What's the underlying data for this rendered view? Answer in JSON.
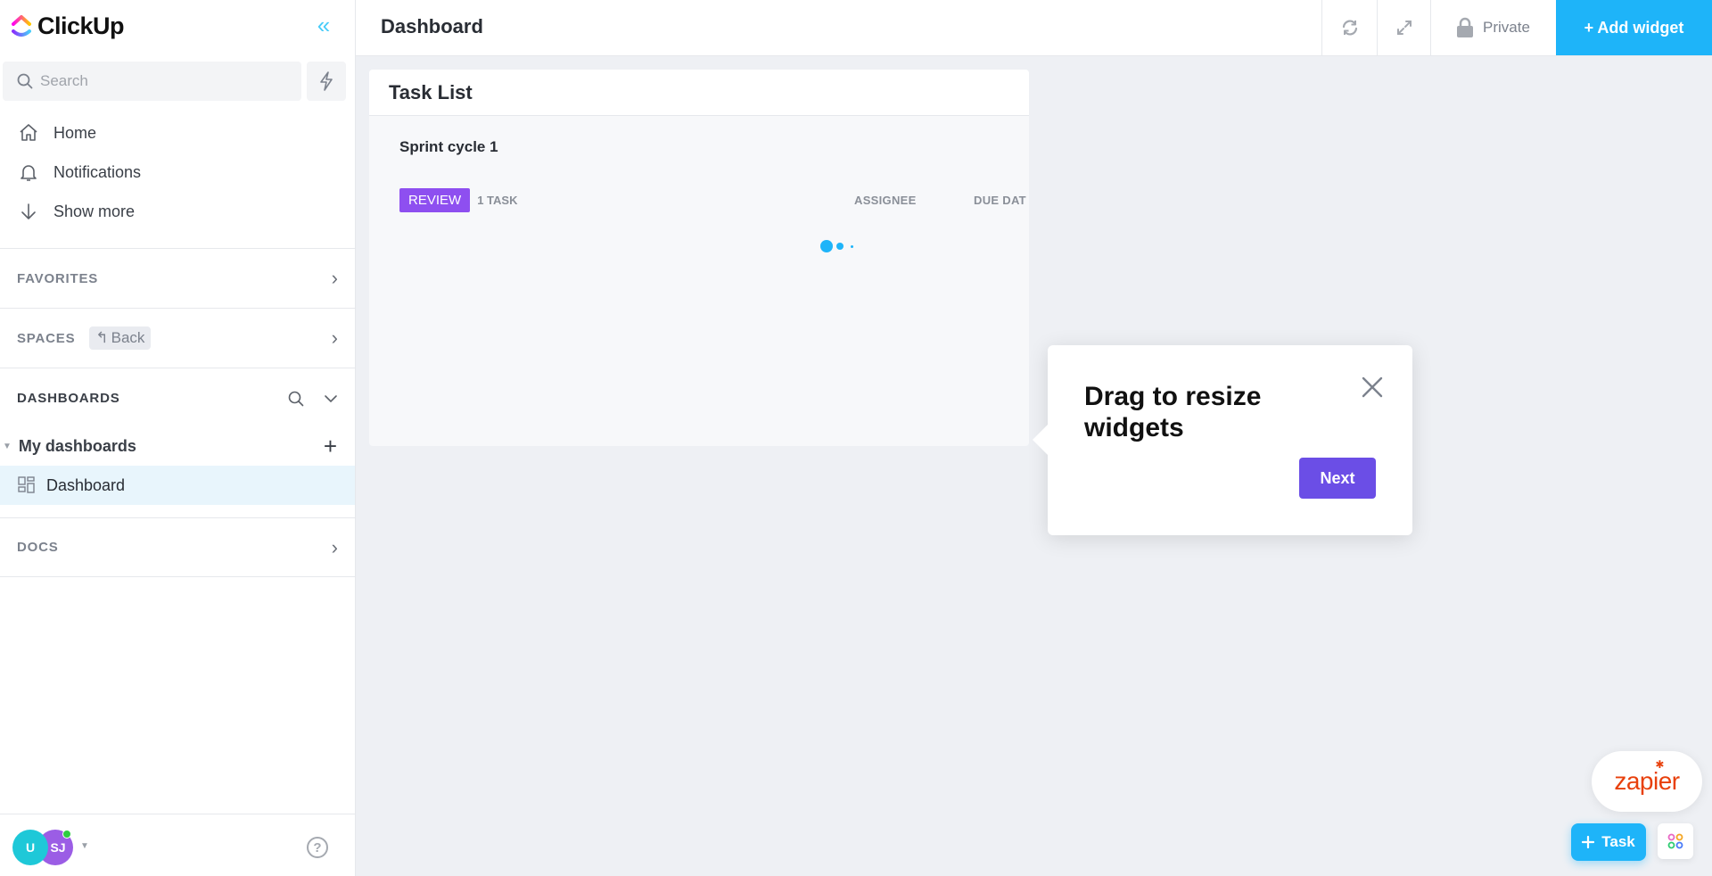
{
  "app": {
    "name": "ClickUp"
  },
  "sidebar": {
    "search_placeholder": "Search",
    "nav": [
      {
        "label": "Home",
        "icon": "home-icon"
      },
      {
        "label": "Notifications",
        "icon": "bell-icon"
      },
      {
        "label": "Show more",
        "icon": "arrow-down-icon"
      }
    ],
    "sections": {
      "favorites": "FAVORITES",
      "spaces": "SPACES",
      "spaces_back": "Back",
      "dashboards": "DASHBOARDS",
      "docs": "DOCS"
    },
    "my_dashboards": "My dashboards",
    "dashboard_items": [
      {
        "label": "Dashboard",
        "active": true
      }
    ],
    "footer": {
      "avatars": [
        {
          "initials": "U",
          "color": "#1ec8d8"
        },
        {
          "initials": "SJ",
          "color": "#9b5de5",
          "online": true
        }
      ],
      "help": "?"
    }
  },
  "header": {
    "title": "Dashboard",
    "privacy": "Private",
    "add_widget": "+ Add widget"
  },
  "widget": {
    "title": "Task List",
    "list_name": "Sprint cycle 1",
    "status": {
      "label": "REVIEW",
      "color": "#8e4ff0"
    },
    "task_count": "1 TASK",
    "columns": [
      "ASSIGNEE",
      "DUE DAT"
    ],
    "loading": true
  },
  "tooltip": {
    "title": "Drag to resize widgets",
    "next": "Next"
  },
  "floating": {
    "zapier": "zapier",
    "task_button": "Task"
  },
  "colors": {
    "accent": "#1eb4f9",
    "primary_purple": "#6b4ee6",
    "zapier_orange": "#e8400c"
  }
}
